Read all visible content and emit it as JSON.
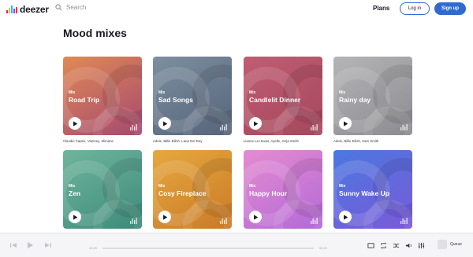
{
  "header": {
    "logo_text": "deezer",
    "logo_colors": [
      "#ff0092",
      "#ffc000",
      "#00c7f2",
      "#a238ff",
      "#ff2c2c"
    ],
    "search_placeholder": "Search",
    "plans_label": "Plans",
    "login_label": "Log in",
    "signup_label": "Sign up"
  },
  "page_title": "Mood mixes",
  "cards": [
    {
      "label": "Mix",
      "title": "Road Trip",
      "artists": "Claudio Capéo, Vianney, Slimane",
      "colors": [
        "#e08a55",
        "#a64870"
      ]
    },
    {
      "label": "Mix",
      "title": "Sad Songs",
      "artists": "Adele, Billie Eilish, Lana Del Rey",
      "colors": [
        "#7d8fa0",
        "#56647a"
      ]
    },
    {
      "label": "Mix",
      "title": "Candlelit Dinner",
      "artists": "Lianne La Havas, Ayelle, Jorja Smith",
      "colors": [
        "#c05d73",
        "#a5475c"
      ]
    },
    {
      "label": "Mix",
      "title": "Rainy day",
      "artists": "Adele, Billie Eilish, Sam Smith",
      "colors": [
        "#b5b5b8",
        "#8c8c90"
      ]
    },
    {
      "label": "Mix",
      "title": "Zen",
      "artists": "",
      "colors": [
        "#6fb59c",
        "#3d8a7a"
      ]
    },
    {
      "label": "Mix",
      "title": "Cosy Fireplace",
      "artists": "",
      "colors": [
        "#e7a83e",
        "#c97a28"
      ]
    },
    {
      "label": "Mix",
      "title": "Happy Hour",
      "artists": "",
      "colors": [
        "#e58bd1",
        "#b36ad6"
      ]
    },
    {
      "label": "Mix",
      "title": "Sunny Wake Up",
      "artists": "",
      "colors": [
        "#4a78e0",
        "#7a5ad8"
      ]
    }
  ],
  "player": {
    "time_start": "00:00",
    "time_end": "00:00",
    "queue_label": "Queue"
  }
}
